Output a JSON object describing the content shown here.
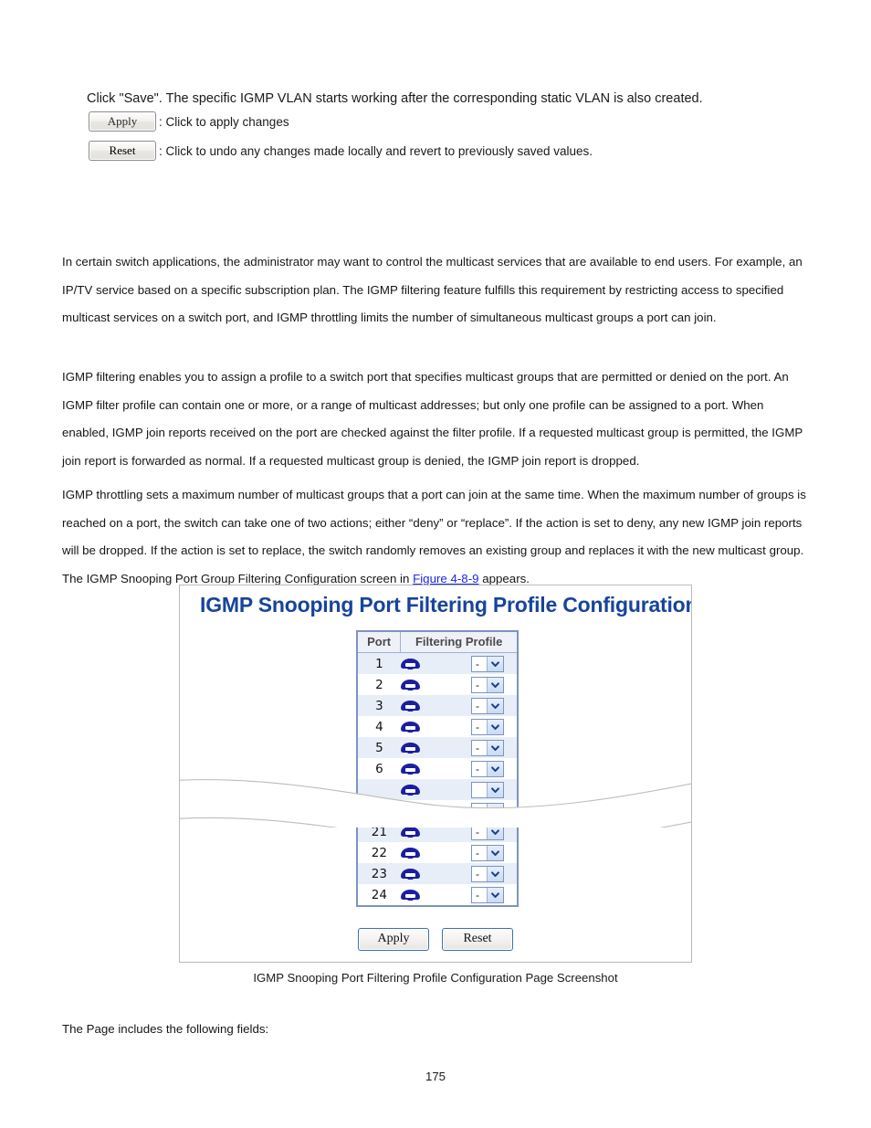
{
  "intro": {
    "lead_text": "Click \"Save\". The specific IGMP VLAN starts working after the corresponding static VLAN is also created.",
    "apply_button_label": "Apply",
    "apply_description": ": Click to apply changes",
    "reset_button_label": "Reset",
    "reset_description": ": Click to undo any changes made locally and revert to previously saved values."
  },
  "paragraphs": {
    "p1": "In certain switch applications, the administrator may want to control the multicast services that are available to end users. For example, an IP/TV service based on a specific subscription plan. The IGMP filtering feature fulfills this requirement by restricting access to specified multicast services on a switch port, and IGMP throttling limits the number of simultaneous multicast groups a port can join.",
    "p2": "IGMP filtering enables you to assign a profile to a switch port that specifies multicast groups that are permitted or denied on the port. An IGMP filter profile can contain one or more, or a range of multicast addresses; but only one profile can be assigned to a port. When enabled, IGMP join reports received on the port are checked against the filter profile. If a requested multicast group is permitted, the IGMP join report is forwarded as normal. If a requested multicast group is denied, the IGMP join report is dropped.",
    "p3_before_link": "IGMP throttling sets a maximum number of multicast groups that a port can join at the same time. When the maximum number of groups is reached on a port, the switch can take one of two actions; either “deny” or “replace”. If the action is set to deny, any new IGMP join reports will be dropped. If the action is set to replace, the switch randomly removes an existing group and replaces it with the new multicast group. The IGMP Snooping Port Group Filtering Configuration screen in ",
    "p3_link": "Figure 4-8-9",
    "p3_after_link": " appears."
  },
  "figure": {
    "title": "IGMP Snooping Port Filtering Profile Configuration",
    "table": {
      "headers": [
        "Port",
        "Filtering Profile"
      ],
      "rows_top": [
        {
          "port": "1",
          "icon": "port-jack-icon",
          "profile_value": "-"
        },
        {
          "port": "2",
          "icon": "port-jack-icon",
          "profile_value": "-"
        },
        {
          "port": "3",
          "icon": "port-jack-icon",
          "profile_value": "-"
        },
        {
          "port": "4",
          "icon": "port-jack-icon",
          "profile_value": "-"
        },
        {
          "port": "5",
          "icon": "port-jack-icon",
          "profile_value": "-"
        },
        {
          "port": "6",
          "icon": "port-jack-icon",
          "profile_value": "-"
        }
      ],
      "rows_bottom": [
        {
          "port": "21",
          "icon": "port-jack-icon",
          "profile_value": "-"
        },
        {
          "port": "22",
          "icon": "port-jack-icon",
          "profile_value": "-"
        },
        {
          "port": "23",
          "icon": "port-jack-icon",
          "profile_value": "-"
        },
        {
          "port": "24",
          "icon": "port-jack-icon",
          "profile_value": "-"
        }
      ]
    },
    "apply_button_label": "Apply",
    "reset_button_label": "Reset",
    "title_color": "#17449b",
    "header_bg": "#eef2f8",
    "row_stripe_color": "#e8eef7",
    "table_border_color": "#7d93c0"
  },
  "caption": "IGMP Snooping Port Filtering Profile Configuration Page Screenshot",
  "footer_note": "The Page includes the following fields:",
  "page_number": "175",
  "link_color": "#1d27e0"
}
